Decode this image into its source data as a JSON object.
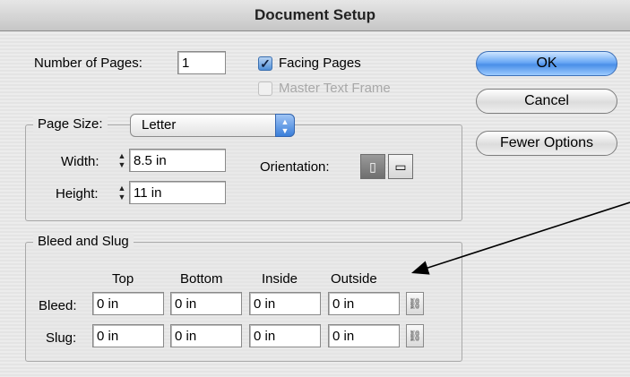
{
  "window": {
    "title": "Document Setup"
  },
  "pages": {
    "number_label": "Number of Pages:",
    "number_value": "1",
    "facing_label": "Facing Pages",
    "facing_checked": true,
    "master_label": "Master Text Frame",
    "master_checked": false
  },
  "buttons": {
    "ok": "OK",
    "cancel": "Cancel",
    "fewer": "Fewer Options"
  },
  "page_size": {
    "label": "Page Size:",
    "selected": "Letter",
    "width_label": "Width:",
    "width_value": "8.5 in",
    "height_label": "Height:",
    "height_value": "11 in",
    "orientation_label": "Orientation:",
    "orientation_selected": "portrait"
  },
  "bleed_slug": {
    "title": "Bleed and Slug",
    "columns": [
      "Top",
      "Bottom",
      "Inside",
      "Outside"
    ],
    "bleed_label": "Bleed:",
    "bleed_values": [
      "0 in",
      "0 in",
      "0 in",
      "0 in"
    ],
    "slug_label": "Slug:",
    "slug_values": [
      "0 in",
      "0 in",
      "0 in",
      "0 in"
    ]
  },
  "icons": {
    "stepper": "stepper-arrows-icon",
    "portrait": "portrait-orientation-icon",
    "landscape": "landscape-orientation-icon",
    "chain": "chain-link-icon",
    "popup": "popup-arrows-icon"
  },
  "colors": {
    "accent": "#4a8fe8",
    "window_bg": "#eaeaea",
    "annotation_arrow": "#000000"
  }
}
